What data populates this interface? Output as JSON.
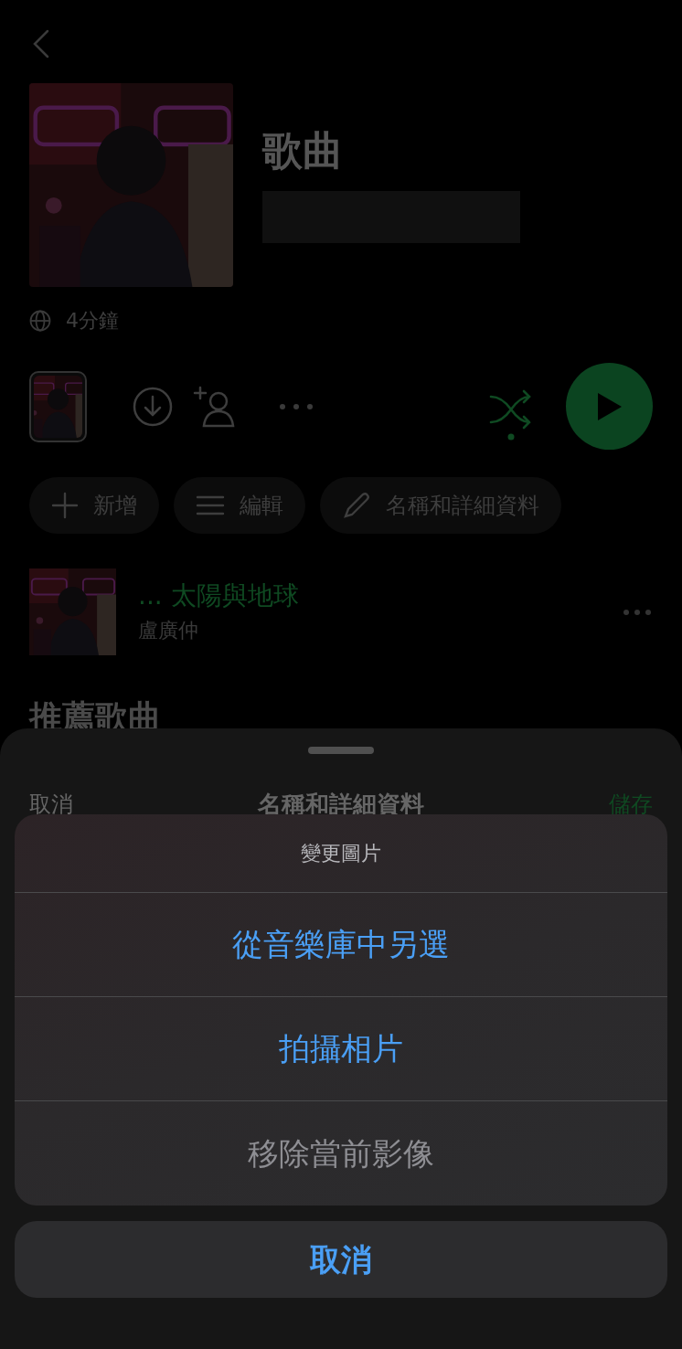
{
  "playlist": {
    "title": "歌曲",
    "duration": "4分鐘"
  },
  "actions": [
    {
      "label": "新增",
      "kind": "add"
    },
    {
      "label": "編輯",
      "kind": "edit"
    },
    {
      "label": "名稱和詳細資料",
      "kind": "rename"
    }
  ],
  "songs": [
    {
      "title": "... 太陽與地球",
      "artist": "盧廣仲"
    }
  ],
  "section_title": "推薦歌曲",
  "sheet": {
    "cancel": "取消",
    "title": "名稱和詳細資料",
    "save": "儲存"
  },
  "action_sheet": {
    "title": "變更圖片",
    "options": [
      {
        "label": "從音樂庫中另選",
        "disabled": false
      },
      {
        "label": "拍攝相片",
        "disabled": false
      },
      {
        "label": "移除當前影像",
        "disabled": true
      }
    ],
    "cancel": "取消"
  }
}
